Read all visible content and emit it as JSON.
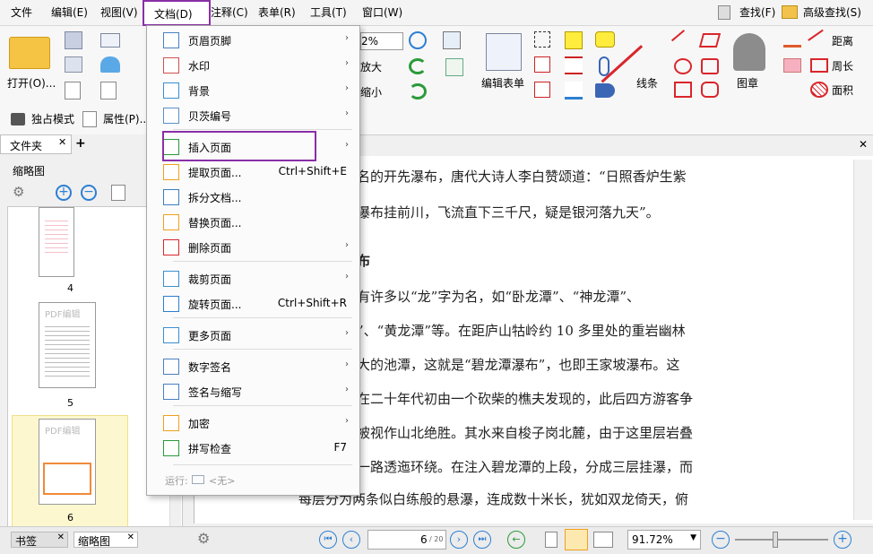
{
  "menubar": {
    "items": [
      "文件",
      "编辑(E)",
      "视图(V)",
      "文档(D)",
      "注释(C)",
      "表单(R)",
      "工具(T)",
      "窗口(W)"
    ],
    "find": "查找(F)",
    "advanced_find": "高级查找(S)"
  },
  "ribbon": {
    "open": "打开(O)...",
    "zoom_value": "2%",
    "enlarge": "放大",
    "shrink": "缩小",
    "edit_form": "编辑表单",
    "lines": "线条",
    "shapes": "图章",
    "distance": "距离",
    "perimeter": "周长",
    "area": "面积",
    "exclusive_mode": "独占模式",
    "properties": "属性(P)..."
  },
  "left_panel": {
    "folder_tab": "文件夹",
    "thumbnails_title": "缩略图",
    "bookmarks_tab": "书签",
    "thumbnails_tab": "缩略图",
    "pages": [
      "4",
      "5",
      "6"
    ],
    "thumb_watermark": "PDF编辑"
  },
  "document": {
    "lines": [
      "名的开先瀑布，唐代大诗人李白赞颂道：“日照香炉生紫",
      "瀑布挂前川，飞流直下三千尺，疑是银河落九天”。",
      "布",
      "有许多以“龙”字为名，如“卧龙潭”、“神龙潭”、",
      "”、“黄龙潭”等。在距庐山牯岭约 10 多里处的重岩幽林",
      "大的池潭，这就是“碧龙潭瀑布”，也即王家坡瀑布。这",
      "在二十年代初由一个砍柴的樵夫发现的，此后四方游客争",
      "被视作山北绝胜。其水来自梭子岗北麓，由于这里层岩叠",
      "一路透迤环绕。在注入碧龙潭的上段，分成三层挂瀑，而",
      "每层分为两条似白练般的悬瀑，连成数十米长，犹如双龙倚天，俯"
    ]
  },
  "status": {
    "page_current": "6",
    "page_total": "/ 20",
    "zoom": "91.72%"
  },
  "doc_menu": {
    "items": [
      {
        "label": "页眉页脚",
        "shortcut": "",
        "submenu": true
      },
      {
        "label": "水印",
        "shortcut": "",
        "submenu": true
      },
      {
        "label": "背景",
        "shortcut": "",
        "submenu": true
      },
      {
        "label": "贝茨编号",
        "shortcut": "",
        "submenu": true
      },
      {
        "label": "插入页面",
        "shortcut": "",
        "submenu": true
      },
      {
        "label": "提取页面...",
        "shortcut": "Ctrl+Shift+E",
        "submenu": false
      },
      {
        "label": "拆分文档...",
        "shortcut": "",
        "submenu": false
      },
      {
        "label": "替换页面...",
        "shortcut": "",
        "submenu": false
      },
      {
        "label": "删除页面",
        "shortcut": "",
        "submenu": true
      },
      {
        "label": "裁剪页面",
        "shortcut": "",
        "submenu": true
      },
      {
        "label": "旋转页面...",
        "shortcut": "Ctrl+Shift+R",
        "submenu": false
      },
      {
        "label": "更多页面",
        "shortcut": "",
        "submenu": true
      },
      {
        "label": "数字签名",
        "shortcut": "",
        "submenu": true
      },
      {
        "label": "签名与缩写",
        "shortcut": "",
        "submenu": true
      },
      {
        "label": "加密",
        "shortcut": "",
        "submenu": true
      },
      {
        "label": "拼写检查",
        "shortcut": "F7",
        "submenu": false
      }
    ],
    "run_label": "运行:",
    "run_value": "<无>"
  },
  "colors": {
    "highlight": "#8a2fa8",
    "accent_blue": "#2d7fd3",
    "accent_red": "#d9262b"
  }
}
